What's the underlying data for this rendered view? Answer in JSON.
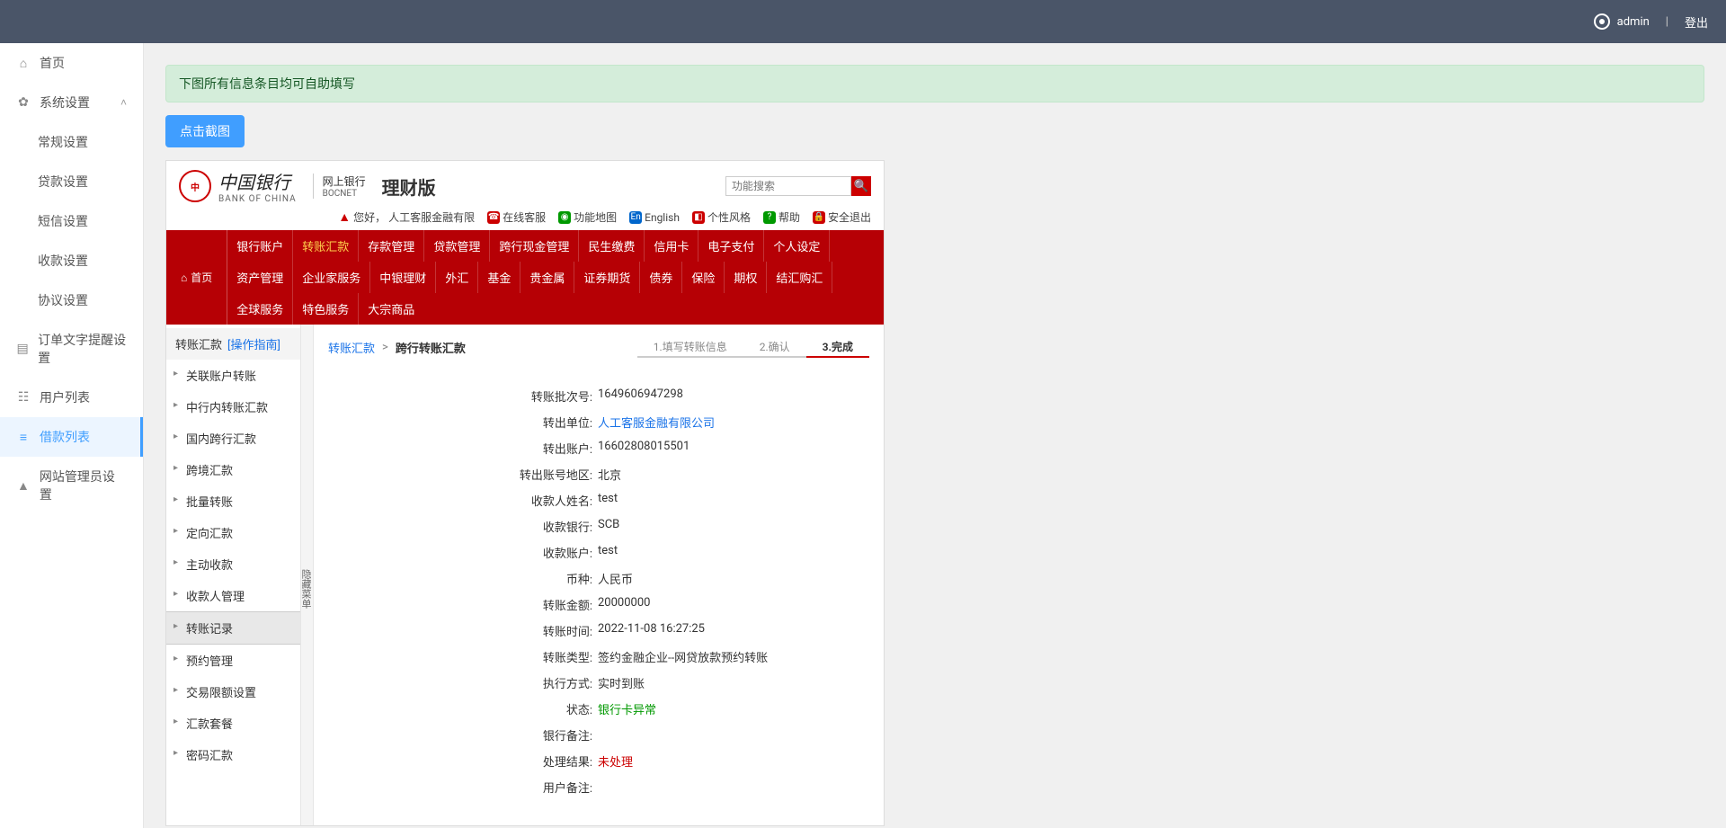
{
  "topbar": {
    "user": "admin",
    "logout": "登出"
  },
  "sidebar": {
    "home": "首页",
    "system": "系统设置",
    "system_children": [
      "常规设置",
      "贷款设置",
      "短信设置",
      "收款设置",
      "协议设置"
    ],
    "order_text": "订单文字提醒设置",
    "user_list": "用户列表",
    "loan_list": "借款列表",
    "admin": "网站管理员设置"
  },
  "alert": "下图所有信息条目均可自助填写",
  "screenshot_btn": "点击截图",
  "bank": {
    "name_zh": "中国银行",
    "name_en": "BANK OF CHINA",
    "net1": "网上银行",
    "net2": "BOCNET",
    "version": "理财版",
    "search_placeholder": "功能搜索",
    "greeting_prefix": "您好，",
    "greeting_name": "人工客服金融有限",
    "util": {
      "online_cs": "在线客服",
      "map": "功能地图",
      "english": "English",
      "style": "个性风格",
      "help": "帮助",
      "safe_exit": "安全退出"
    },
    "nav_home": "首页",
    "nav_row1": [
      "银行账户",
      "转账汇款",
      "存款管理",
      "贷款管理",
      "跨行现金管理",
      "民生缴费",
      "信用卡",
      "电子支付",
      "个人设定",
      "资产管理",
      "企业家服务"
    ],
    "nav_row2": [
      "中银理财",
      "外汇",
      "基金",
      "贵金属",
      "证券期货",
      "债券",
      "保险",
      "期权",
      "结汇购汇",
      "全球服务",
      "特色服务",
      "大宗商品"
    ],
    "left_title": "转账汇款",
    "left_guide": "[操作指南]",
    "left_items": [
      "关联账户转账",
      "中行内转账汇款",
      "国内跨行汇款",
      "跨境汇款",
      "批量转账",
      "定向汇款",
      "主动收款",
      "收款人管理",
      "转账记录",
      "预约管理",
      "交易限额设置",
      "汇款套餐",
      "密码汇款"
    ],
    "left_selected_index": 8,
    "handle": "隐藏菜单",
    "crumb1": "转账汇款",
    "crumb2": "跨行转账汇款",
    "steps": [
      "1.填写转账信息",
      "2.确认",
      "3.完成"
    ],
    "details": [
      {
        "label": "转账批次号:",
        "value": "1649606947298"
      },
      {
        "label": "转出单位:",
        "value": "人工客服金融有限公司",
        "cls": "link"
      },
      {
        "label": "转出账户:",
        "value": "16602808015501"
      },
      {
        "label": "转出账号地区:",
        "value": "北京"
      },
      {
        "label": "收款人姓名:",
        "value": "test"
      },
      {
        "label": "收款银行:",
        "value": "SCB"
      },
      {
        "label": "收款账户:",
        "value": "test"
      },
      {
        "label": "币种:",
        "value": "人民币"
      },
      {
        "label": "转账金额:",
        "value": "20000000"
      },
      {
        "label": "转账时间:",
        "value": "2022-11-08 16:27:25"
      },
      {
        "label": "转账类型:",
        "value": "签约金融企业--网贷放款预约转账"
      },
      {
        "label": "执行方式:",
        "value": "实时到账"
      },
      {
        "label": "状态:",
        "value": "银行卡异常",
        "cls": "green"
      },
      {
        "label": "银行备注:",
        "value": ""
      },
      {
        "label": "处理结果:",
        "value": "未处理",
        "cls": "red"
      },
      {
        "label": "用户备注:",
        "value": ""
      }
    ]
  }
}
